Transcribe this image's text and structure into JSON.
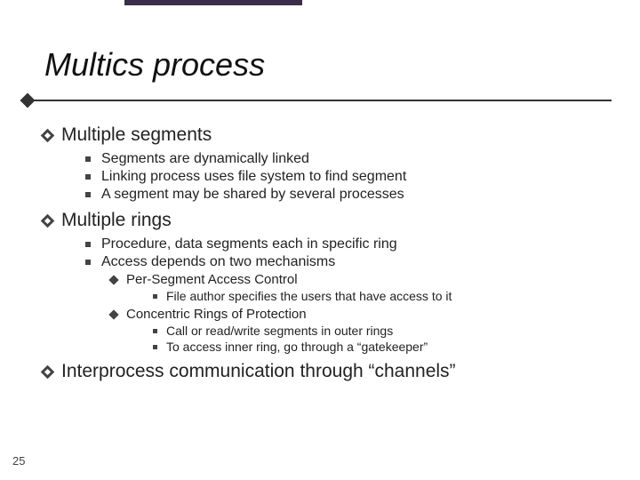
{
  "title": "Multics process",
  "page_number": "25",
  "sections": {
    "seg_title": "Multiple segments",
    "seg_items": {
      "a": "Segments are dynamically linked",
      "b": "Linking process uses file system to find segment",
      "c": "A segment may be shared by several processes"
    },
    "rings_title": "Multiple rings",
    "rings_items": {
      "a": "Procedure, data segments each in specific ring",
      "b": "Access depends on two mechanisms"
    },
    "mech1_title": "Per-Segment Access Control",
    "mech1_items": {
      "a": "File author specifies the users that have access to it"
    },
    "mech2_title": "Concentric Rings of Protection",
    "mech2_items": {
      "a": "Call or read/write segments in outer rings",
      "b": "To access inner ring, go through a “gatekeeper”"
    },
    "ipc_title": "Interprocess communication through “channels”"
  }
}
